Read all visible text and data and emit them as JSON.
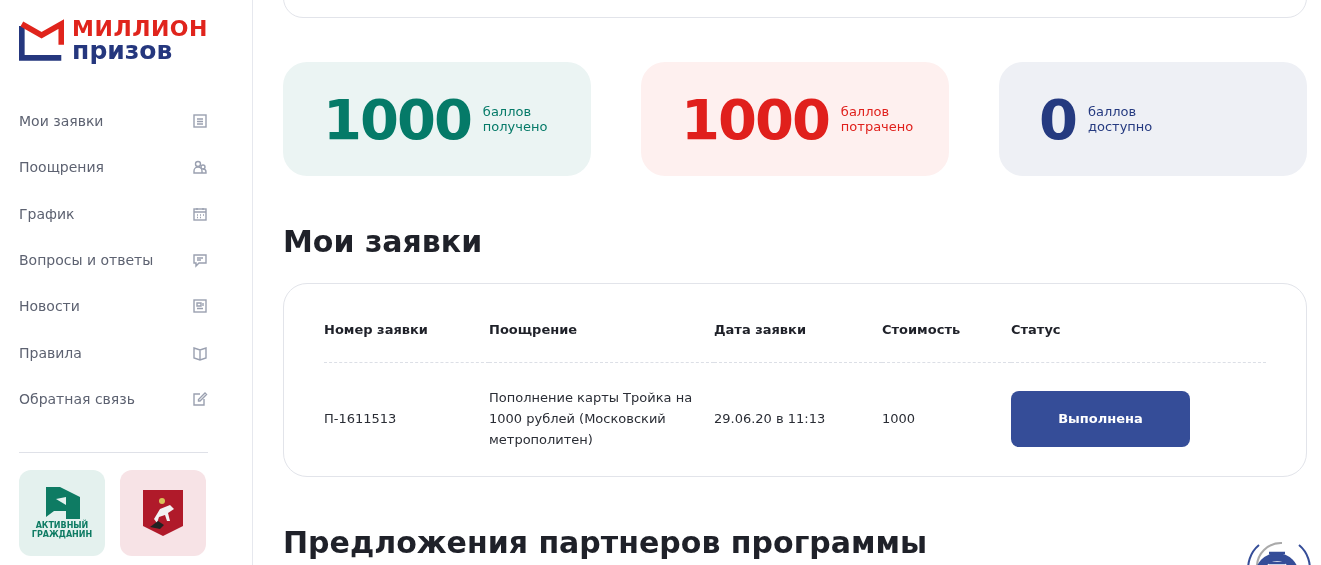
{
  "logo": {
    "line_1": "МИЛЛИОН",
    "line_2": "призов"
  },
  "sidebar": {
    "items": [
      {
        "label": "Мои заявки"
      },
      {
        "label": "Поощрения"
      },
      {
        "label": "График"
      },
      {
        "label": "Вопросы и ответы"
      },
      {
        "label": "Новости"
      },
      {
        "label": "Правила"
      },
      {
        "label": "Обратная связь"
      }
    ],
    "partners": [
      {
        "kind": "active_citizen",
        "caption": "АКТИВНЫЙ ГРАЖДАНИН"
      },
      {
        "kind": "moscow"
      }
    ]
  },
  "stats": [
    {
      "kind": "received",
      "value": "1000",
      "unit": "баллов",
      "caption": "получено"
    },
    {
      "kind": "spent",
      "value": "1000",
      "unit": "баллов",
      "caption": "потрачено"
    },
    {
      "kind": "available",
      "value": "0",
      "unit": "баллов",
      "caption": "доступно"
    }
  ],
  "orders": {
    "title": "Мои заявки",
    "columns": [
      "Номер заявки",
      "Поощрение",
      "Дата заявки",
      "Стоимость",
      "Статус"
    ],
    "rows": [
      {
        "number": "П-1611513",
        "reward": "Пополнение карты Тройка на 1000 рублей (Московский метрополитен)",
        "date": "29.06.20 в 11:13",
        "cost": "1000",
        "status": "Выполнена"
      }
    ]
  },
  "partners_section": {
    "title": "Предложения партнеров программы"
  }
}
